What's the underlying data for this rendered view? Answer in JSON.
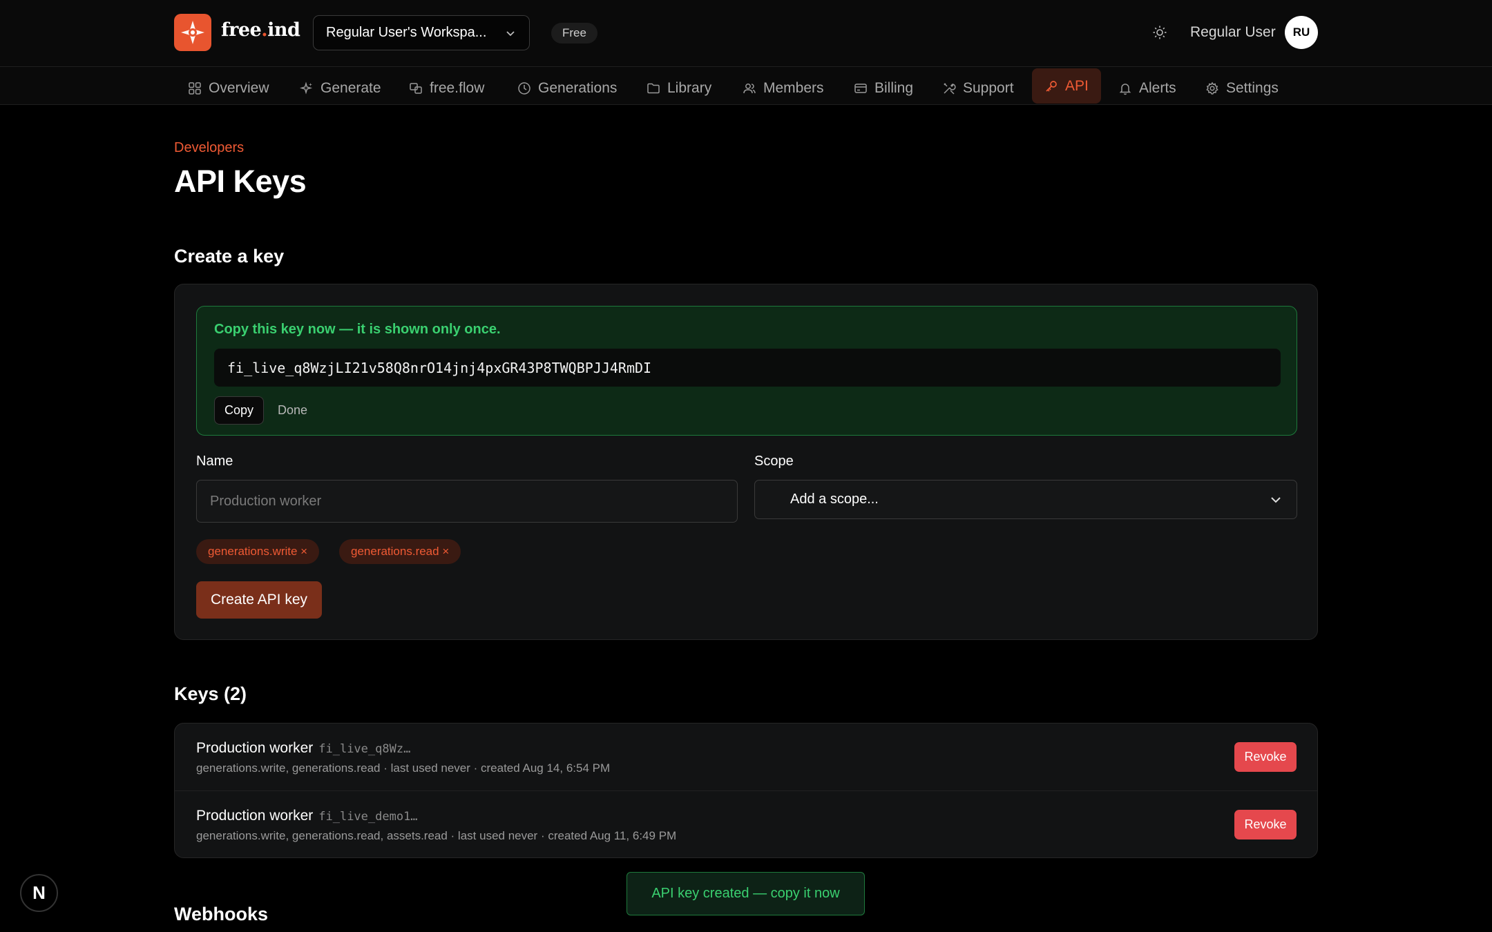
{
  "brand": {
    "name_main": "free",
    "name_dot": ".",
    "name_end": "ind",
    "accent": "#e8552f"
  },
  "header": {
    "workspace": "Regular User's Workspa...",
    "plan": "Free",
    "user_name": "Regular User",
    "avatar_initials": "RU"
  },
  "nav": [
    {
      "label": "Overview",
      "icon": "grid-icon"
    },
    {
      "label": "Generate",
      "icon": "sparkle-icon"
    },
    {
      "label": "free.flow",
      "icon": "flow-icon"
    },
    {
      "label": "Generations",
      "icon": "clock-icon"
    },
    {
      "label": "Library",
      "icon": "folder-icon"
    },
    {
      "label": "Members",
      "icon": "users-icon"
    },
    {
      "label": "Billing",
      "icon": "card-icon"
    },
    {
      "label": "Support",
      "icon": "tools-icon"
    },
    {
      "label": "API",
      "icon": "key-icon",
      "active": true
    },
    {
      "label": "Alerts",
      "icon": "bell-icon"
    },
    {
      "label": "Settings",
      "icon": "gear-icon"
    }
  ],
  "page": {
    "eyebrow": "Developers",
    "title": "API Keys"
  },
  "create": {
    "title": "Create a key",
    "success_message": "Copy this key now — it is shown only once.",
    "new_key": "fi_live_q8WzjLI21v58Q8nrO14jnj4pxGR43P8TWQBPJJ4RmDI",
    "copy_label": "Copy",
    "done_label": "Done",
    "name_label": "Name",
    "name_placeholder": "Production worker",
    "scope_label": "Scope",
    "scope_placeholder": "Add a scope...",
    "chips": [
      "generations.write ×",
      "generations.read ×"
    ],
    "submit_label": "Create API key"
  },
  "keys": {
    "title": "Keys (2)",
    "items": [
      {
        "name": "Production worker",
        "prefix": "fi_live_q8Wz…",
        "meta": "generations.write, generations.read · last used never · created Aug 14, 6:54 PM",
        "revoke": "Revoke"
      },
      {
        "name": "Production worker",
        "prefix": "fi_live_demo1…",
        "meta": "generations.write, generations.read, assets.read · last used never · created Aug 11, 6:49 PM",
        "revoke": "Revoke"
      }
    ]
  },
  "webhooks": {
    "title": "Webhooks"
  },
  "toast": "API key created — copy it now",
  "dev_badge": "N"
}
